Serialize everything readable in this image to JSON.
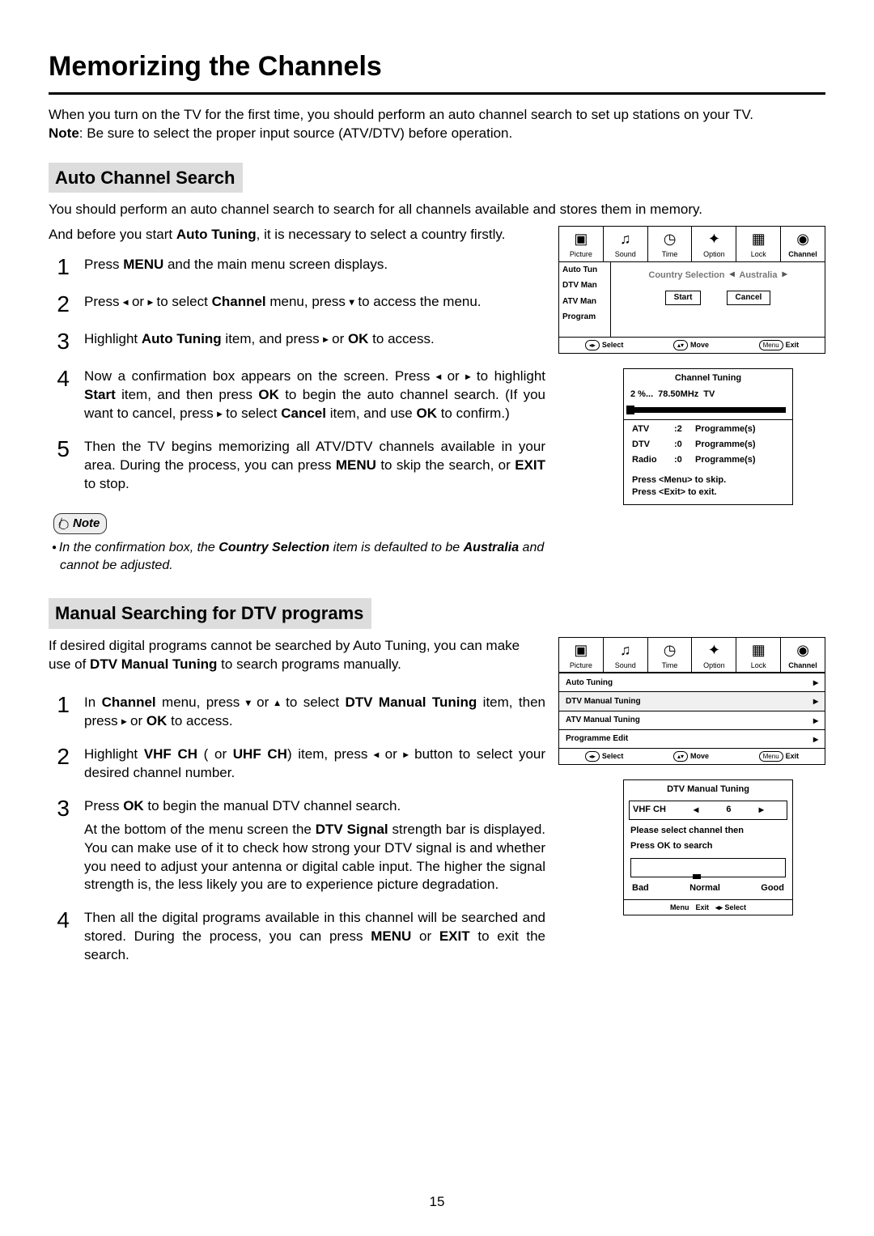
{
  "page": {
    "title": "Memorizing the Channels",
    "intro_line1": "When you turn on the TV for the first time, you should perform an auto channel search to set up stations on your TV.",
    "note_label": "Note",
    "intro_note": ": Be sure to select the proper input source (ATV/DTV) before operation.",
    "number": "15"
  },
  "section1": {
    "heading": "Auto Channel Search",
    "lead1": "You should perform an auto channel search to search for all channels available and stores them in memory.",
    "lead2_a": "And before you start ",
    "lead2_b": "Auto Tuning",
    "lead2_c": ", it is necessary to select a country firstly.",
    "steps": [
      {
        "n": "1",
        "html": "Press <b>MENU</b> and the main menu screen displays."
      },
      {
        "n": "2",
        "html": "Press <span class='arrow'>◂</span> or <span class='arrow'>▸</span> to select <b>Channel</b> menu,  press <span class='arrow'>▾</span> to access the menu."
      },
      {
        "n": "3",
        "html": "Highlight <b>Auto Tuning</b> item, and press <span class='arrow'>▸</span> or <b>OK</b> to access."
      },
      {
        "n": "4",
        "html": "Now a confirmation box appears on the screen. Press <span class='arrow'>◂</span> or <span class='arrow'>▸</span> to highlight <b>Start</b> item, and then press <b>OK</b> to begin the auto channel search. (If you want to cancel, press <span class='arrow'>▸</span> to select <b>Cancel</b> item, and use <b>OK</b> to confirm.)"
      },
      {
        "n": "5",
        "html": "Then the TV begins memorizing all ATV/DTV channels available in your area. During the process, you can press <b>MENU</b> to skip the search, or <b>EXIT</b> to stop."
      }
    ],
    "note_pill": "Note",
    "note_body_a": "In the confirmation box, the ",
    "note_body_b": "Country Selection",
    "note_body_c": " item is defaulted to be ",
    "note_body_d": "Australia",
    "note_body_e": " and cannot be adjusted."
  },
  "section2": {
    "heading": "Manual Searching for DTV programs",
    "lead_a": "If desired digital programs cannot be searched by Auto Tuning, you can make use of ",
    "lead_b": "DTV Manual Tuning",
    "lead_c": " to search programs manually.",
    "steps": [
      {
        "n": "1",
        "html": "In <b>Channel</b> menu,  press <span class='arrow'>▾</span> or <span class='arrow'>▴</span> to select <b>DTV Manual Tuning</b> item, then press <span class='arrow'>▸</span> or <b>OK</b> to access."
      },
      {
        "n": "2",
        "html": "Highlight <b>VHF CH</b> ( or <b>UHF CH</b>) item, press <span class='arrow'>◂</span> or <span class='arrow'>▸</span> button to select your desired channel number."
      },
      {
        "n": "3",
        "html": "Press <b>OK</b> to begin the manual DTV channel search.<div style='height:6px'></div>At the bottom of the menu screen the <b>DTV Signal</b> strength bar is displayed. You can make use of it to check how strong your DTV signal is and whether you need to adjust your antenna or digital cable input. The higher the signal strength is, the less likely you are to experience picture degradation."
      },
      {
        "n": "4",
        "html": "Then all the digital programs available in this channel will be searched and stored. During the process, you can press <b>MENU</b> or <b>EXIT</b> to exit the search."
      }
    ]
  },
  "osd": {
    "tabs": [
      {
        "label": "Picture",
        "icon": "▣"
      },
      {
        "label": "Sound",
        "icon": "♫"
      },
      {
        "label": "Time",
        "icon": "◷"
      },
      {
        "label": "Option",
        "icon": "✦"
      },
      {
        "label": "Lock",
        "icon": "▦"
      },
      {
        "label": "Channel",
        "icon": "◉"
      }
    ],
    "fig1": {
      "side": [
        "Auto Tun",
        "DTV Man",
        "ATV Man",
        "Program"
      ],
      "country_label": "Country Selection",
      "country_value": "Australia",
      "btn_start": "Start",
      "btn_cancel": "Cancel",
      "hints_select": "Select",
      "hints_move": "Move",
      "hints_menu": "Menu",
      "hints_exit": "Exit"
    },
    "fig2": {
      "title": "Channel  Tuning",
      "percent": "2  %...",
      "freq": "78.50MHz",
      "band": "TV",
      "rows": [
        {
          "k": "ATV",
          "v": ":2",
          "t": "Programme(s)"
        },
        {
          "k": "DTV",
          "v": ":0",
          "t": "Programme(s)"
        },
        {
          "k": "Radio",
          "v": ":0",
          "t": "Programme(s)"
        }
      ],
      "tip1": "Press <Menu> to skip.",
      "tip2": "Press <Exit> to exit."
    },
    "fig3_rows": [
      "Auto Tuning",
      "DTV Manual Tuning",
      "ATV Manual Tuning",
      "Programme Edit"
    ],
    "fig4": {
      "title": "DTV Manual Tuning",
      "ch_label": "VHF  CH",
      "ch_value": "6",
      "txt1": "Please select channel then",
      "txt2": "Press OK to search",
      "bad": "Bad",
      "normal": "Normal",
      "good": "Good",
      "menu": "Menu",
      "exit": "Exit",
      "select": "Select"
    }
  }
}
